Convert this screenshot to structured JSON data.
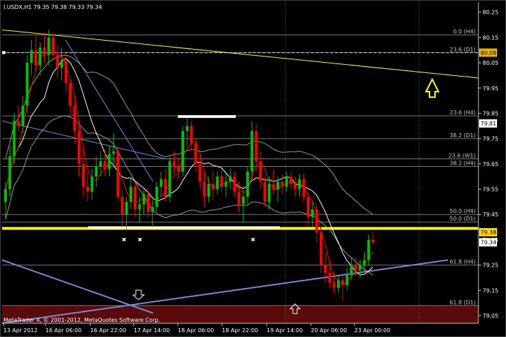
{
  "chart_data": {
    "type": "candlestick",
    "title": "I.USDX,H1  79.35 79.38 79.33 79.34",
    "symbol": "I.USDX,H1",
    "ohlc_header": "79.35 79.38 79.33 79.34",
    "ylim": [
      79.02,
      80.29
    ],
    "y_ticks": [
      "80.25",
      "80.15",
      "80.05",
      "79.95",
      "79.85",
      "79.75",
      "79.65",
      "79.55",
      "79.45",
      "79.35",
      "79.25",
      "79.15",
      "79.05"
    ],
    "x_ticks": [
      "13 Apr 2012",
      "16 Apr 06:00",
      "16 Apr 22:00",
      "17 Apr 14:00",
      "18 Apr 06:00",
      "18 Apr 22:00",
      "19 Apr 14:00",
      "20 Apr 06:00",
      "23 Apr 00:00"
    ],
    "candles": [
      {
        "o": 79.5,
        "h": 79.58,
        "l": 79.43,
        "c": 79.55
      },
      {
        "o": 79.55,
        "h": 79.72,
        "l": 79.52,
        "c": 79.68
      },
      {
        "o": 79.68,
        "h": 79.85,
        "l": 79.65,
        "c": 79.82
      },
      {
        "o": 79.82,
        "h": 79.88,
        "l": 79.78,
        "c": 79.8
      },
      {
        "o": 79.8,
        "h": 79.92,
        "l": 79.77,
        "c": 79.88
      },
      {
        "o": 79.88,
        "h": 80.08,
        "l": 79.85,
        "c": 80.05
      },
      {
        "o": 80.05,
        "h": 80.14,
        "l": 80.0,
        "c": 80.1
      },
      {
        "o": 80.1,
        "h": 80.16,
        "l": 80.02,
        "c": 80.04
      },
      {
        "o": 80.04,
        "h": 80.13,
        "l": 80.0,
        "c": 80.11
      },
      {
        "o": 80.11,
        "h": 80.17,
        "l": 80.05,
        "c": 80.08
      },
      {
        "o": 80.08,
        "h": 80.18,
        "l": 80.04,
        "c": 80.15
      },
      {
        "o": 80.15,
        "h": 80.17,
        "l": 80.06,
        "c": 80.08
      },
      {
        "o": 80.08,
        "h": 80.12,
        "l": 79.99,
        "c": 80.03
      },
      {
        "o": 80.03,
        "h": 80.11,
        "l": 79.98,
        "c": 80.06
      },
      {
        "o": 80.06,
        "h": 80.09,
        "l": 79.93,
        "c": 79.97
      },
      {
        "o": 79.97,
        "h": 79.99,
        "l": 79.84,
        "c": 79.88
      },
      {
        "o": 79.88,
        "h": 79.92,
        "l": 79.73,
        "c": 79.78
      },
      {
        "o": 79.78,
        "h": 79.82,
        "l": 79.6,
        "c": 79.65
      },
      {
        "o": 79.65,
        "h": 79.72,
        "l": 79.52,
        "c": 79.56
      },
      {
        "o": 79.56,
        "h": 79.62,
        "l": 79.5,
        "c": 79.54
      },
      {
        "o": 79.54,
        "h": 79.63,
        "l": 79.51,
        "c": 79.6
      },
      {
        "o": 79.6,
        "h": 79.68,
        "l": 79.56,
        "c": 79.64
      },
      {
        "o": 79.64,
        "h": 79.7,
        "l": 79.6,
        "c": 79.66
      },
      {
        "o": 79.66,
        "h": 79.71,
        "l": 79.6,
        "c": 79.63
      },
      {
        "o": 79.63,
        "h": 79.72,
        "l": 79.6,
        "c": 79.69
      },
      {
        "o": 79.69,
        "h": 79.77,
        "l": 79.64,
        "c": 79.7
      },
      {
        "o": 79.7,
        "h": 79.72,
        "l": 79.5,
        "c": 79.52
      },
      {
        "o": 79.52,
        "h": 79.55,
        "l": 79.4,
        "c": 79.45
      },
      {
        "o": 79.45,
        "h": 79.52,
        "l": 79.39,
        "c": 79.5
      },
      {
        "o": 79.5,
        "h": 79.6,
        "l": 79.47,
        "c": 79.56
      },
      {
        "o": 79.56,
        "h": 79.58,
        "l": 79.44,
        "c": 79.47
      },
      {
        "o": 79.47,
        "h": 79.52,
        "l": 79.42,
        "c": 79.49
      },
      {
        "o": 79.49,
        "h": 79.55,
        "l": 79.45,
        "c": 79.53
      },
      {
        "o": 79.53,
        "h": 79.55,
        "l": 79.44,
        "c": 79.46
      },
      {
        "o": 79.46,
        "h": 79.51,
        "l": 79.4,
        "c": 79.48
      },
      {
        "o": 79.48,
        "h": 79.58,
        "l": 79.46,
        "c": 79.56
      },
      {
        "o": 79.56,
        "h": 79.62,
        "l": 79.52,
        "c": 79.59
      },
      {
        "o": 79.59,
        "h": 79.63,
        "l": 79.5,
        "c": 79.52
      },
      {
        "o": 79.52,
        "h": 79.68,
        "l": 79.5,
        "c": 79.66
      },
      {
        "o": 79.66,
        "h": 79.7,
        "l": 79.61,
        "c": 79.64
      },
      {
        "o": 79.64,
        "h": 79.68,
        "l": 79.59,
        "c": 79.62
      },
      {
        "o": 79.62,
        "h": 79.8,
        "l": 79.6,
        "c": 79.78
      },
      {
        "o": 79.78,
        "h": 79.83,
        "l": 79.72,
        "c": 79.8
      },
      {
        "o": 79.8,
        "h": 79.82,
        "l": 79.7,
        "c": 79.73
      },
      {
        "o": 79.73,
        "h": 79.75,
        "l": 79.62,
        "c": 79.65
      },
      {
        "o": 79.65,
        "h": 79.69,
        "l": 79.55,
        "c": 79.58
      },
      {
        "o": 79.58,
        "h": 79.62,
        "l": 79.48,
        "c": 79.52
      },
      {
        "o": 79.52,
        "h": 79.6,
        "l": 79.5,
        "c": 79.57
      },
      {
        "o": 79.57,
        "h": 79.62,
        "l": 79.51,
        "c": 79.55
      },
      {
        "o": 79.55,
        "h": 79.62,
        "l": 79.53,
        "c": 79.6
      },
      {
        "o": 79.6,
        "h": 79.63,
        "l": 79.54,
        "c": 79.56
      },
      {
        "o": 79.56,
        "h": 79.61,
        "l": 79.52,
        "c": 79.58
      },
      {
        "o": 79.58,
        "h": 79.63,
        "l": 79.55,
        "c": 79.6
      },
      {
        "o": 79.6,
        "h": 79.62,
        "l": 79.52,
        "c": 79.54
      },
      {
        "o": 79.54,
        "h": 79.58,
        "l": 79.46,
        "c": 79.49
      },
      {
        "o": 79.49,
        "h": 79.55,
        "l": 79.42,
        "c": 79.52
      },
      {
        "o": 79.52,
        "h": 79.64,
        "l": 79.49,
        "c": 79.62
      },
      {
        "o": 79.62,
        "h": 79.82,
        "l": 79.58,
        "c": 79.78
      },
      {
        "o": 79.78,
        "h": 79.81,
        "l": 79.62,
        "c": 79.66
      },
      {
        "o": 79.66,
        "h": 79.7,
        "l": 79.55,
        "c": 79.58
      },
      {
        "o": 79.58,
        "h": 79.6,
        "l": 79.48,
        "c": 79.5
      },
      {
        "o": 79.5,
        "h": 79.6,
        "l": 79.47,
        "c": 79.57
      },
      {
        "o": 79.57,
        "h": 79.63,
        "l": 79.53,
        "c": 79.55
      },
      {
        "o": 79.55,
        "h": 79.6,
        "l": 79.5,
        "c": 79.58
      },
      {
        "o": 79.58,
        "h": 79.61,
        "l": 79.53,
        "c": 79.56
      },
      {
        "o": 79.56,
        "h": 79.62,
        "l": 79.54,
        "c": 79.6
      },
      {
        "o": 79.6,
        "h": 79.62,
        "l": 79.55,
        "c": 79.57
      },
      {
        "o": 79.57,
        "h": 79.6,
        "l": 79.52,
        "c": 79.55
      },
      {
        "o": 79.55,
        "h": 79.61,
        "l": 79.52,
        "c": 79.59
      },
      {
        "o": 79.59,
        "h": 79.61,
        "l": 79.5,
        "c": 79.52
      },
      {
        "o": 79.52,
        "h": 79.54,
        "l": 79.4,
        "c": 79.44
      },
      {
        "o": 79.44,
        "h": 79.5,
        "l": 79.4,
        "c": 79.47
      },
      {
        "o": 79.47,
        "h": 79.49,
        "l": 79.34,
        "c": 79.38
      },
      {
        "o": 79.38,
        "h": 79.4,
        "l": 79.22,
        "c": 79.25
      },
      {
        "o": 79.25,
        "h": 79.3,
        "l": 79.18,
        "c": 79.22
      },
      {
        "o": 79.22,
        "h": 79.27,
        "l": 79.16,
        "c": 79.18
      },
      {
        "o": 79.18,
        "h": 79.22,
        "l": 79.14,
        "c": 79.16
      },
      {
        "o": 79.16,
        "h": 79.21,
        "l": 79.14,
        "c": 79.19
      },
      {
        "o": 79.19,
        "h": 79.21,
        "l": 79.11,
        "c": 79.17
      },
      {
        "o": 79.17,
        "h": 79.24,
        "l": 79.15,
        "c": 79.21
      },
      {
        "o": 79.21,
        "h": 79.28,
        "l": 79.19,
        "c": 79.25
      },
      {
        "o": 79.25,
        "h": 79.28,
        "l": 79.21,
        "c": 79.23
      },
      {
        "o": 79.23,
        "h": 79.27,
        "l": 79.2,
        "c": 79.25
      },
      {
        "o": 79.25,
        "h": 79.3,
        "l": 79.22,
        "c": 79.27
      },
      {
        "o": 79.27,
        "h": 79.37,
        "l": 79.25,
        "c": 79.35
      },
      {
        "o": 79.35,
        "h": 79.38,
        "l": 79.33,
        "c": 79.34
      }
    ],
    "fib_levels": [
      {
        "label": "0.0 (H4)",
        "value": 80.16
      },
      {
        "label": "23.6 (D1)",
        "value": 80.09
      },
      {
        "label": "23.6 (H4)",
        "value": 79.84
      },
      {
        "label": "38.2 (D1)",
        "value": 79.75
      },
      {
        "label": "23.6 (W1)",
        "value": 79.67
      },
      {
        "label": "38.2 (H4)",
        "value": 79.64
      },
      {
        "label": "50.0 (H4)",
        "value": 79.45
      },
      {
        "label": "50.0 (D1)",
        "value": 79.42
      },
      {
        "label": "61.8 (H4)",
        "value": 79.25
      },
      {
        "label": "61.8 (D1)",
        "value": 79.09
      }
    ],
    "price_tags": [
      {
        "label": "80.09",
        "value": 80.09,
        "bg": "#f0b400",
        "fg": "#000000"
      },
      {
        "label": "79.81",
        "value": 79.81,
        "bg": "#ffffff",
        "fg": "#000000"
      },
      {
        "label": "79.38",
        "value": 79.38,
        "bg": "#ffd700",
        "fg": "#000000"
      },
      {
        "label": "79.34",
        "value": 79.34,
        "bg": "#ffffff",
        "fg": "#000000"
      }
    ],
    "copyright": "MetaTrader 4, © 2001-2012, MetaQuotes Software Corp.",
    "colors": {
      "background": "#000000",
      "bull": "#00c000",
      "bear": "#ff0000",
      "grid": "#7a7a7a",
      "support": "#ffff00",
      "trendline": "#6f8fe0",
      "zone": "#5a0a0a",
      "fast_ma": "#ff0000",
      "slow_ma": "#ffffff",
      "envelope": "#a0a0a0"
    }
  }
}
